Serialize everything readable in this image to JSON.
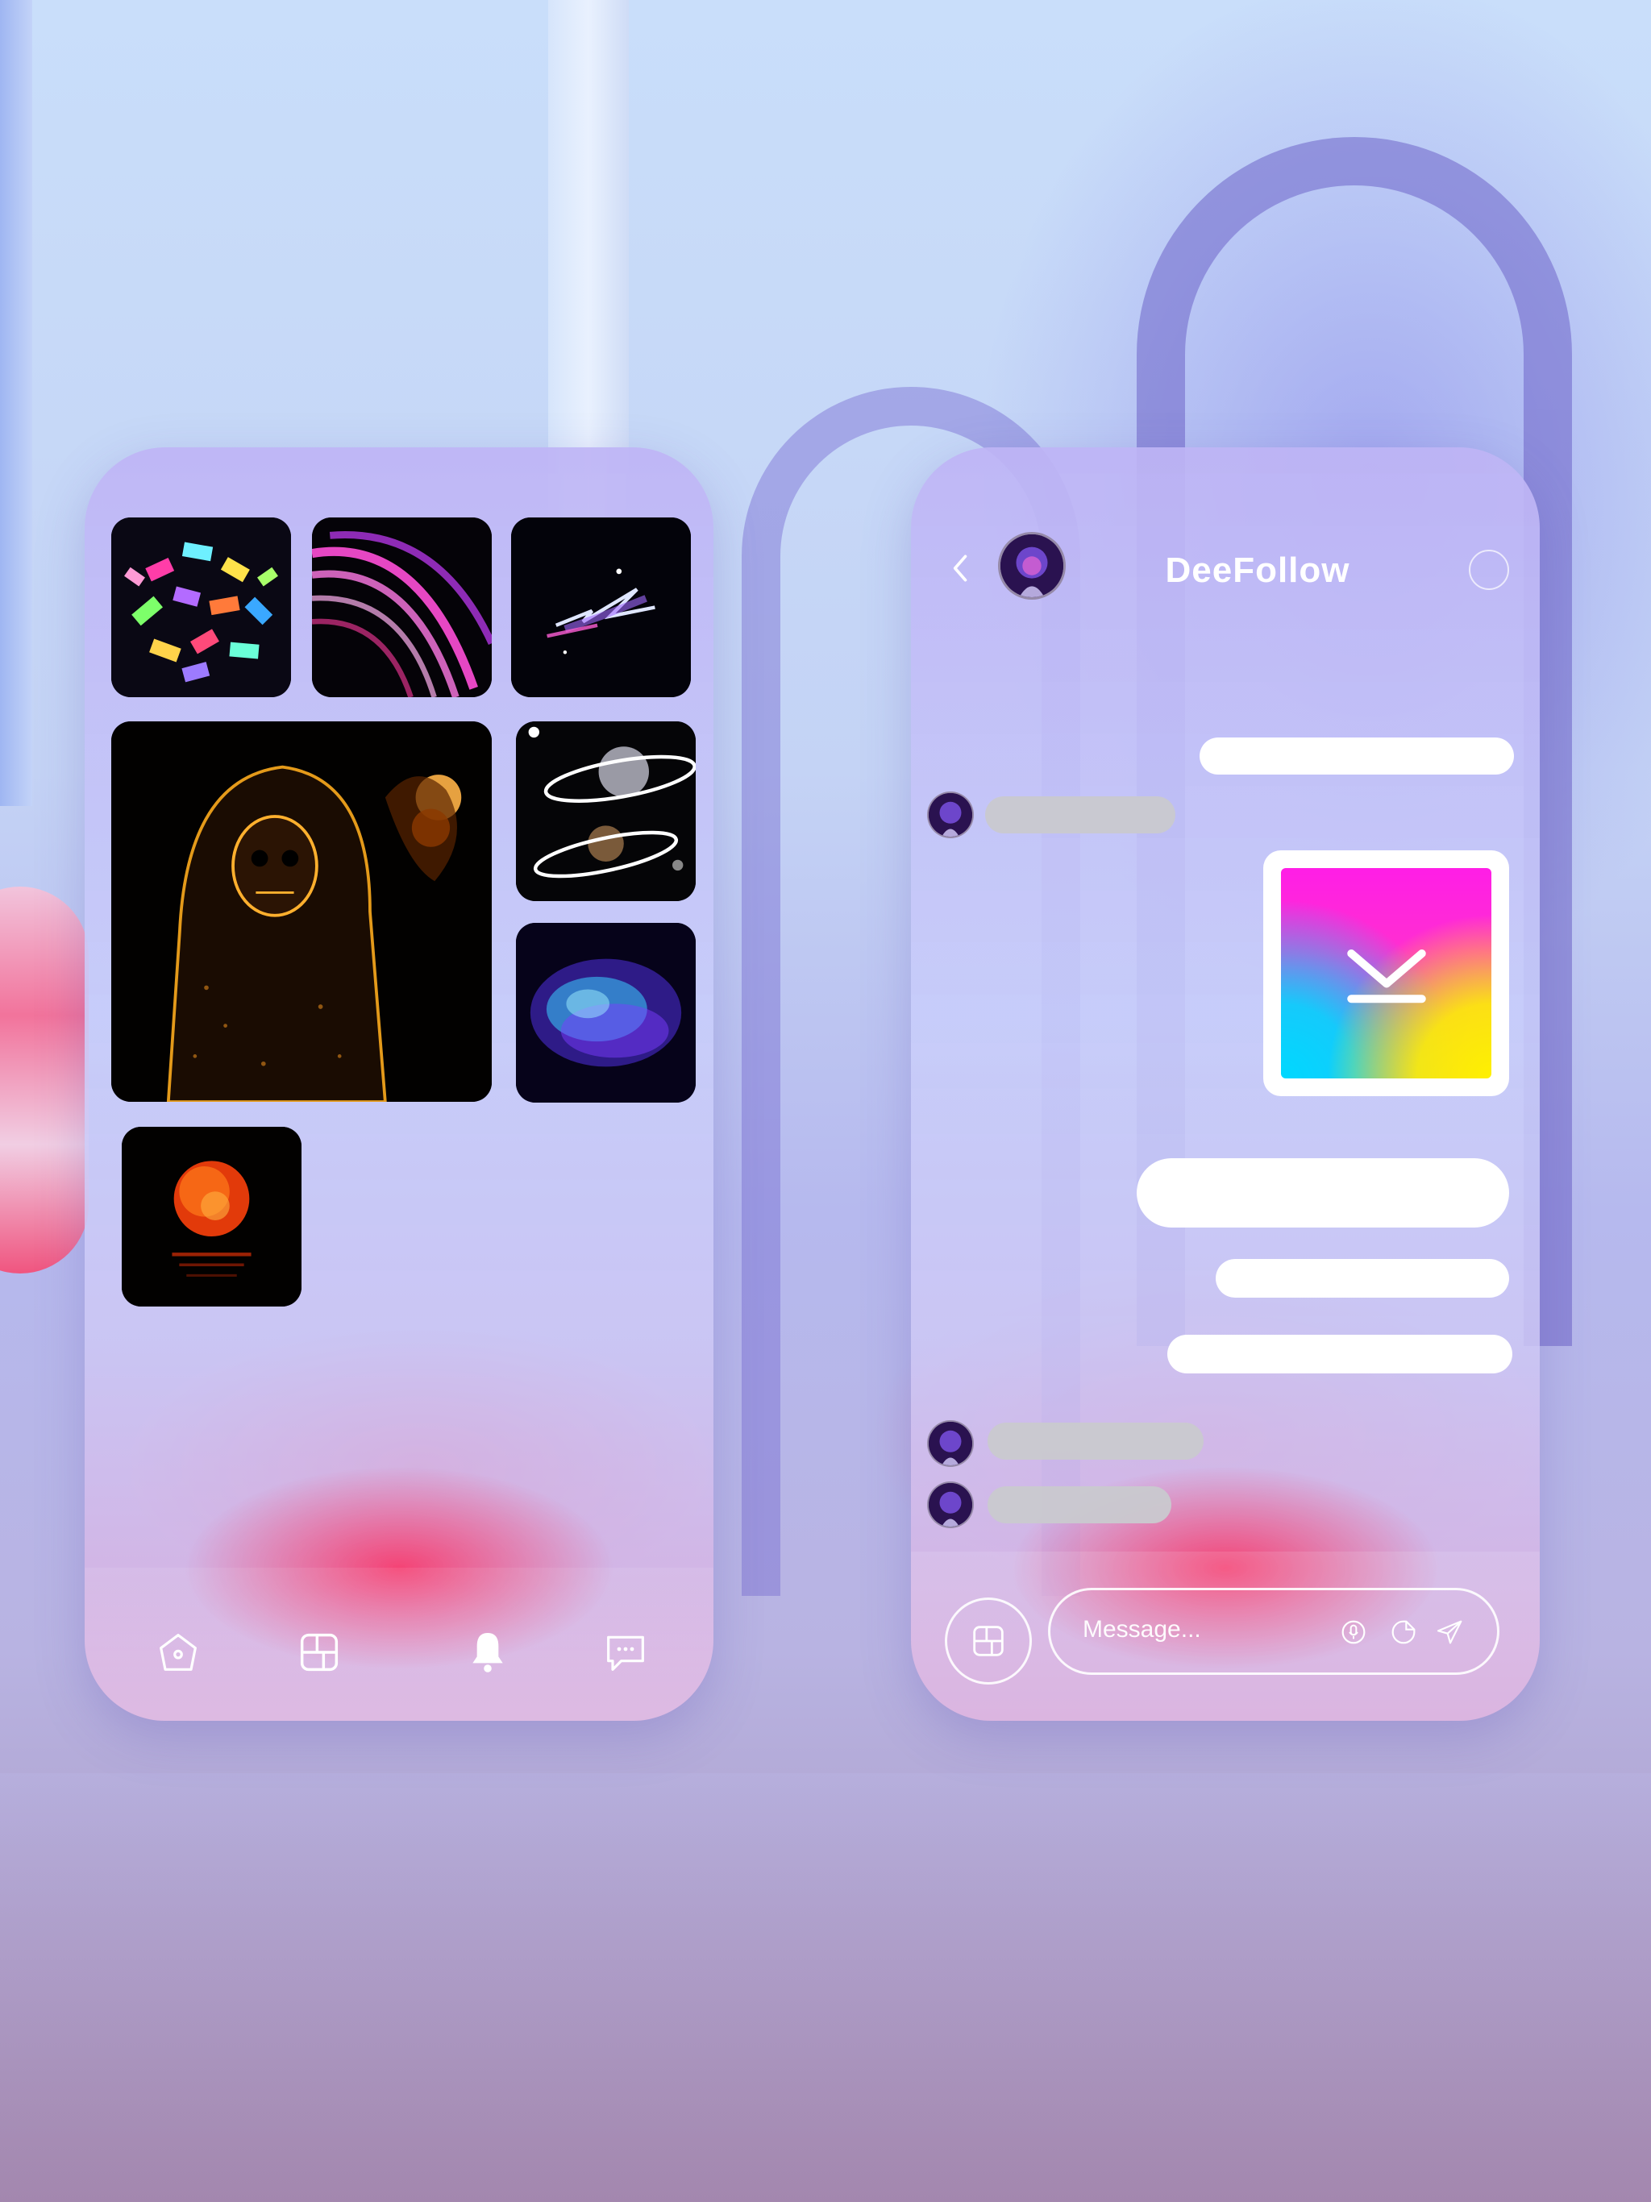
{
  "gallery": {
    "items": [
      {
        "name": "colorful-blocks-art"
      },
      {
        "name": "pink-light-streaks-art"
      },
      {
        "name": "neon-lightning-art"
      },
      {
        "name": "glowing-hooded-skull-art"
      },
      {
        "name": "chrome-planets-art"
      },
      {
        "name": "blue-particle-cloud-art"
      },
      {
        "name": "red-sun-reflection-art"
      }
    ]
  },
  "bottom_nav": {
    "items": [
      {
        "icon": "home-icon",
        "active": false
      },
      {
        "icon": "gallery-icon",
        "active": false
      },
      {
        "icon": "bell-icon",
        "active": true
      },
      {
        "icon": "chat-icon",
        "active": false
      }
    ]
  },
  "chat": {
    "title": "DeeFollow",
    "input_placeholder": "Message...",
    "icons": {
      "back": "chevron-left-icon",
      "info": "info-icon",
      "attach": "gallery-icon",
      "voice": "microphone-icon",
      "sticker": "sticker-icon",
      "send": "send-icon"
    },
    "image_message": {
      "icon": "download-icon",
      "gradient": [
        "#ff1ee6",
        "#00d8ff",
        "#fff000"
      ]
    }
  },
  "colors": {
    "accent_pink": "#ff2a6a",
    "bubble_out": "#ffffff",
    "bubble_in": "#c9c9cf"
  }
}
